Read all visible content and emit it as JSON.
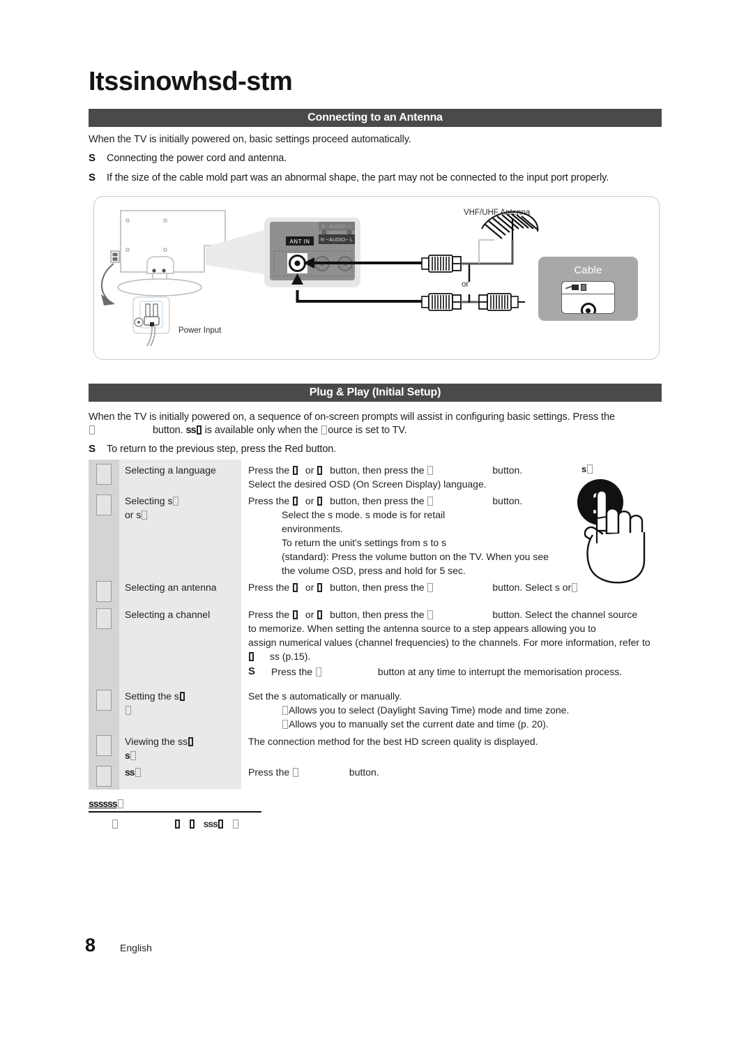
{
  "document": {
    "title": "Itssinowhsd-stm",
    "page_number": "8",
    "language": "English"
  },
  "sections": [
    {
      "id": "antenna",
      "heading": "Connecting to an Antenna",
      "intro": "When the TV is initially powered on, basic settings proceed automatically.",
      "bullets": [
        {
          "mark": "S",
          "text": "Connecting the power cord and antenna."
        },
        {
          "mark": "S",
          "text": "If the size of the cable mold part was an abnormal shape, the part may not be connected to the input port properly."
        }
      ],
      "diagram": {
        "power_input_label": "Power Input",
        "antenna_label": "VHF/UHF Antenna",
        "or_label": "or",
        "ant_in_label": "ANT IN",
        "audio_label": "R −AUDIO− L",
        "cable_box_label": "Cable"
      }
    },
    {
      "id": "plugplay",
      "heading": "Plug & Play (Initial Setup)",
      "intro_line1": "When the TV is initially powered on, a sequence of on-screen prompts will assist in configuring basic settings. Press the",
      "intro_line2_pre": "button.",
      "intro_line2_mid": "is available only when the",
      "intro_line2_post": "ource is set to TV.",
      "bullets": [
        {
          "mark": "S",
          "text": "To return to the previous step, press the Red button."
        }
      ]
    }
  ],
  "steps": [
    {
      "label": "Selecting a language",
      "label_extra": "",
      "lines": [
        {
          "type": "main",
          "pre": "Press the",
          "mid": "or",
          "mid2": "button, then press the",
          "post": "button."
        },
        {
          "type": "plain",
          "text": "Select the desired OSD (On Screen Display) language."
        }
      ]
    },
    {
      "label": "Selecting s",
      "label_extra": "or s",
      "lines": [
        {
          "type": "main",
          "pre": "Press the",
          "mid": "or",
          "mid2": "button, then press the",
          "post": "button."
        },
        {
          "type": "indent",
          "text": "Select the s mode. s mode is for retail"
        },
        {
          "type": "indent",
          "text": "environments."
        },
        {
          "type": "indent",
          "text": "To return the unit's settings from s to s"
        },
        {
          "type": "indent",
          "text": "(standard): Press the volume button on the TV. When you see"
        },
        {
          "type": "indent",
          "text": "the volume OSD, press and hold  for 5 sec."
        }
      ]
    },
    {
      "label": "Selecting an antenna",
      "label_extra": "",
      "lines": [
        {
          "type": "main",
          "pre": "Press the",
          "mid": "or",
          "mid2": "button, then press the",
          "post": "button. Select s or"
        }
      ]
    },
    {
      "label": "Selecting a channel",
      "label_extra": "",
      "lines": [
        {
          "type": "main",
          "pre": "Press the",
          "mid": "or",
          "mid2": "button, then press the",
          "post": "button. Select the channel source"
        },
        {
          "type": "plain",
          "text": "to memorize. When setting the antenna source to  a step appears allowing you to"
        },
        {
          "type": "plain",
          "text": "assign numerical values (channel frequencies) to the channels. For more information, refer to"
        },
        {
          "type": "plain",
          "text": "ss (p.15)."
        },
        {
          "type": "bullet",
          "mark": "S",
          "text": "Press the            button at any time to interrupt the memorisation process."
        }
      ]
    },
    {
      "label": "Setting the s",
      "label_extra": "□",
      "lines": [
        {
          "type": "plain",
          "text": "Set the s automatically or manually."
        },
        {
          "type": "indent",
          "text": "Allows you to select  (Daylight Saving Time) mode and time zone."
        },
        {
          "type": "indent",
          "text": "Allows you to manually set the current date and time (p. 20)."
        }
      ]
    },
    {
      "label": "Viewing the ss",
      "label_extra": "s",
      "lines": [
        {
          "type": "plain",
          "text": "The connection method for the best HD screen quality is displayed."
        }
      ]
    },
    {
      "label": "ss",
      "label_extra": "",
      "lines": [
        {
          "type": "main2",
          "pre": "Press the",
          "post": "button."
        }
      ]
    }
  ],
  "hand_graphic": {
    "label": "s",
    "number": "1"
  },
  "footnote": {
    "label": "ssssss",
    "glyph_row": "□      □  □  sss □"
  },
  "colors": {
    "section_bar": "#4a4a4a",
    "label_column": "#e9e9e9",
    "icon_column": "#d4d4d4",
    "diagram_border": "#c9c9c9",
    "cable_box": "#a8a8a8"
  }
}
